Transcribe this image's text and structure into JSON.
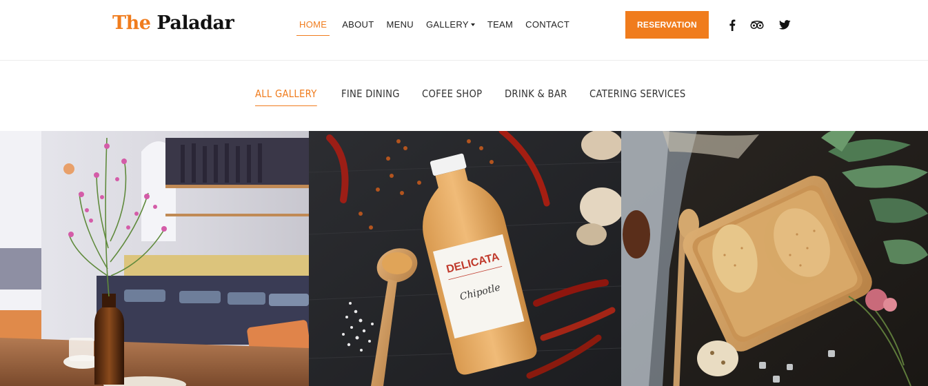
{
  "brand": {
    "the": "The",
    "name": "Paladar",
    "accent": "#f07c1d"
  },
  "nav": {
    "items": [
      {
        "label": "HOME",
        "active": true
      },
      {
        "label": "ABOUT"
      },
      {
        "label": "MENU"
      },
      {
        "label": "GALLERY",
        "dropdown": true
      },
      {
        "label": "TEAM"
      },
      {
        "label": "CONTACT"
      }
    ]
  },
  "header": {
    "reservation_label": "RESERVATION"
  },
  "social": {
    "icons": [
      "facebook-icon",
      "tripadvisor-icon",
      "twitter-icon"
    ]
  },
  "gallery": {
    "filters": [
      {
        "label": "ALL GALLERY",
        "active": true
      },
      {
        "label": "FINE DINING"
      },
      {
        "label": "COFEE SHOP"
      },
      {
        "label": "DRINK & BAR"
      },
      {
        "label": "CATERING SERVICES"
      }
    ],
    "photos": [
      {
        "subject": "restaurant-interior-with-flower-vase"
      },
      {
        "subject": "delicata-chipotle-sauce-bottle",
        "label_brand": "DELICATA",
        "label_flavor": "Chipotle"
      },
      {
        "subject": "cookies-on-wooden-tray"
      }
    ]
  }
}
